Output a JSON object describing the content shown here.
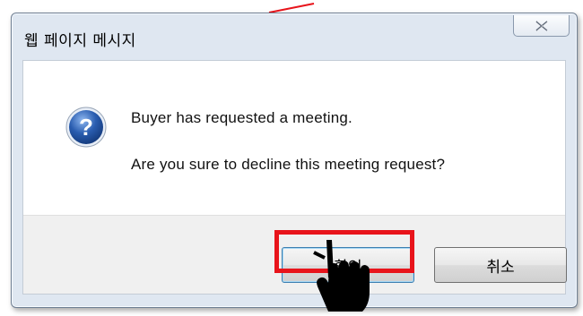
{
  "dialog": {
    "title": "웹 페이지 메시지",
    "message_line1": "Buyer has requested a meeting.",
    "message_line2": "Are you sure to decline this meeting request?",
    "ok_label": "확인",
    "cancel_label": "취소",
    "icon": "question-icon",
    "close_icon": "close-icon"
  },
  "annotation": {
    "highlight_color": "#e8141b",
    "pointer_icon": "hand-pointer-icon"
  },
  "colors": {
    "dialog_frame": "#dfe7f1",
    "content_bg": "#ffffff",
    "button_bar": "#f0f0f0",
    "question_icon": "#2a5db0"
  }
}
